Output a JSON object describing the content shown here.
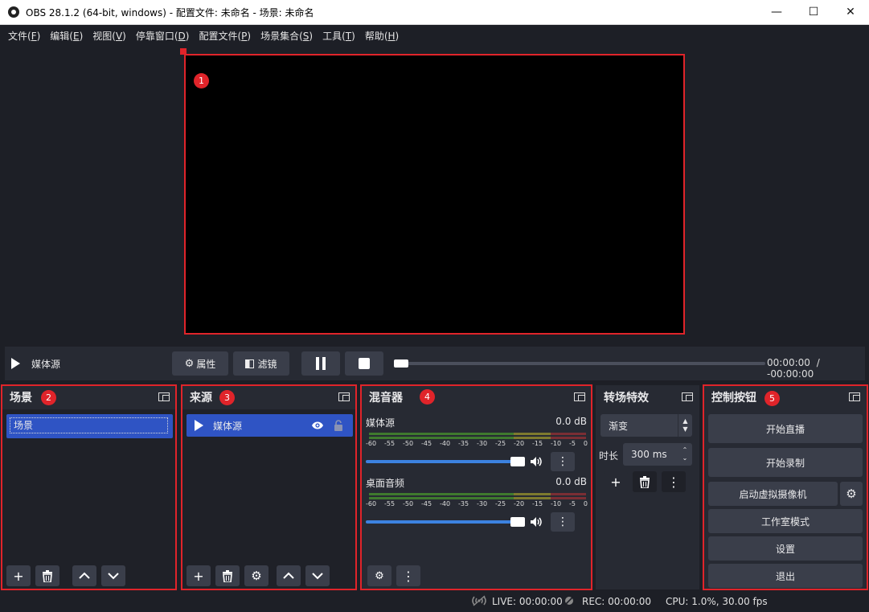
{
  "window": {
    "title": "OBS 28.1.2 (64-bit, windows) - 配置文件: 未命名 - 场景: 未命名"
  },
  "menu": [
    {
      "label": "文件(",
      "key": "F",
      "end": ")"
    },
    {
      "label": "编辑(",
      "key": "E",
      "end": ")"
    },
    {
      "label": "视图(",
      "key": "V",
      "end": ")"
    },
    {
      "label": "停靠窗口(",
      "key": "D",
      "end": ")"
    },
    {
      "label": "配置文件(",
      "key": "P",
      "end": ")"
    },
    {
      "label": "场景集合(",
      "key": "S",
      "end": ")"
    },
    {
      "label": "工具(",
      "key": "T",
      "end": ")"
    },
    {
      "label": "帮助(",
      "key": "H",
      "end": ")"
    }
  ],
  "badges": [
    "1",
    "2",
    "3",
    "4",
    "5"
  ],
  "media": {
    "source_name": "媒体源",
    "properties": "属性",
    "filters": "滤镜",
    "time_current": "00:00:00",
    "time_sep": "/",
    "time_remaining": "-00:00:00",
    "progress": 0
  },
  "scenes": {
    "title": "场景",
    "items": [
      "场景"
    ]
  },
  "sources": {
    "title": "来源",
    "items": [
      "媒体源"
    ]
  },
  "mixer": {
    "title": "混音器",
    "scale": [
      "-60",
      "-55",
      "-50",
      "-45",
      "-40",
      "-35",
      "-30",
      "-25",
      "-20",
      "-15",
      "-10",
      "-5",
      "0"
    ],
    "channels": [
      {
        "name": "媒体源",
        "db": "0.0 dB",
        "volume": 1.0
      },
      {
        "name": "桌面音频",
        "db": "0.0 dB",
        "volume": 1.0
      }
    ]
  },
  "transitions": {
    "title": "转场特效",
    "selected": "渐变",
    "duration_label": "时长",
    "duration_value": "300 ms"
  },
  "controls": {
    "title": "控制按钮",
    "start_stream": "开始直播",
    "start_record": "开始录制",
    "virtual_cam": "启动虚拟摄像机",
    "studio_mode": "工作室模式",
    "settings": "设置",
    "exit": "退出"
  },
  "status": {
    "live": "LIVE: 00:00:00",
    "rec": "REC: 00:00:00",
    "cpu": "CPU: 1.0%, 30.00 fps"
  },
  "colors": {
    "accent": "#2f54c4",
    "highlight": "#e0242a",
    "volume": "#3c82e0"
  }
}
